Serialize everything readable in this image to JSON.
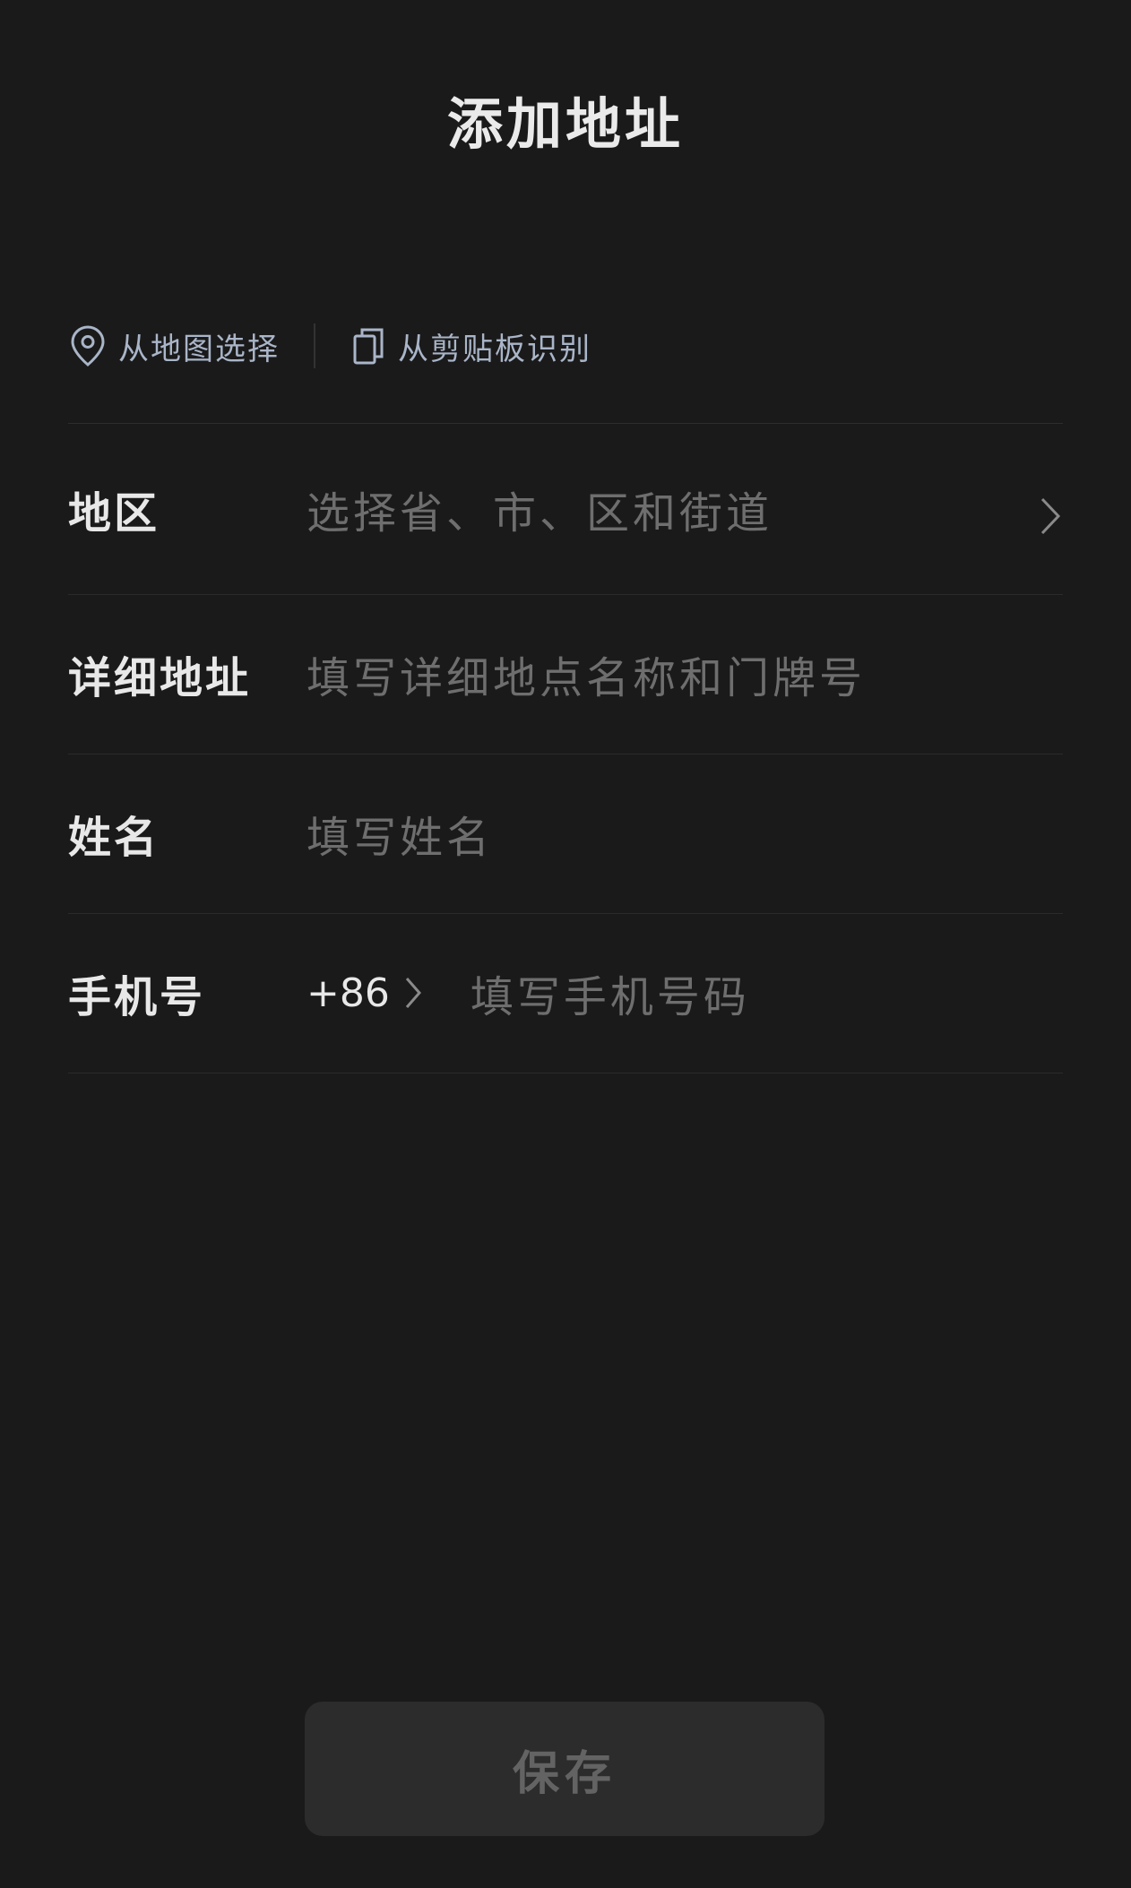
{
  "header": {
    "title": "添加地址"
  },
  "quick_actions": {
    "map_select_label": "从地图选择",
    "clipboard_label": "从剪贴板识别"
  },
  "form": {
    "region": {
      "label": "地区",
      "placeholder": "选择省、市、区和街道"
    },
    "detail_address": {
      "label": "详细地址",
      "placeholder": "填写详细地点名称和门牌号"
    },
    "name": {
      "label": "姓名",
      "placeholder": "填写姓名"
    },
    "phone": {
      "label": "手机号",
      "country_code": "+86",
      "placeholder": "填写手机号码"
    }
  },
  "actions": {
    "save_label": "保存"
  },
  "colors": {
    "background": "#1a1a1a",
    "accent_text": "#a9b5c8",
    "placeholder": "#6e6e6e",
    "button_bg": "#2c2c2c",
    "button_text": "#636363"
  },
  "icons": {
    "map_select": "location-pin-icon",
    "clipboard": "clipboard-icon",
    "region_arrow": "chevron-right-icon",
    "country_code_arrow": "chevron-right-icon"
  }
}
